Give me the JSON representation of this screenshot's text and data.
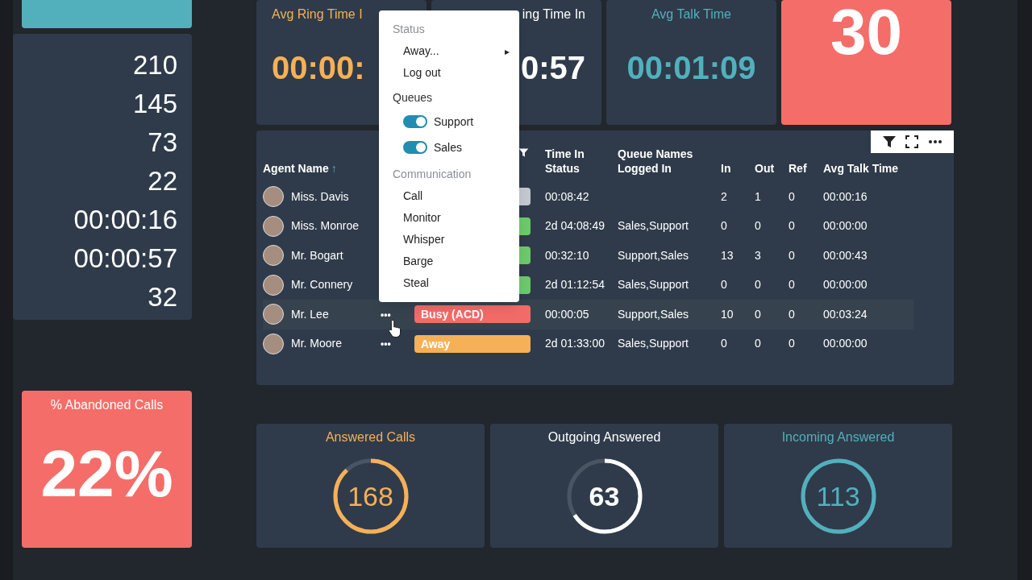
{
  "left_stats": {
    "values": [
      "210",
      "145",
      "73",
      "22",
      "00:00:16",
      "00:00:57",
      "32"
    ]
  },
  "abandoned": {
    "title": "% Abandoned Calls",
    "value": "22%"
  },
  "top_tiles": [
    {
      "kind": "metric",
      "title": "Avg Ring Time I",
      "value": "00:00:"
    },
    {
      "kind": "metric",
      "title": "ing Time In",
      "value": "0:57"
    },
    {
      "kind": "metric",
      "title": "Avg Talk Time",
      "value": "00:01:09"
    },
    {
      "kind": "alert",
      "value": "30"
    }
  ],
  "table": {
    "columns": [
      {
        "kind": "text",
        "label": "Agent Name",
        "sort_indicator": "↑"
      },
      {
        "kind": "blank"
      },
      {
        "kind": "filter"
      },
      {
        "kind": "text",
        "label": "Time In Status"
      },
      {
        "kind": "text",
        "label": "Queue Names Logged In"
      },
      {
        "kind": "text",
        "label": "In"
      },
      {
        "kind": "text",
        "label": "Out"
      },
      {
        "kind": "text",
        "label": "Ref"
      },
      {
        "kind": "text",
        "label": "Avg Talk Time"
      }
    ],
    "rows": [
      {
        "agent": "Miss. Davis",
        "color": "#c3c7cf",
        "time": "00:08:42",
        "queues": "",
        "in": "2",
        "out": "1",
        "ref": "0",
        "avg_talk": "00:00:16",
        "hovered": false
      },
      {
        "agent": "Miss. Monroe",
        "color": "#6cc96a",
        "time": "2d 04:08:49",
        "queues": "Sales,Support",
        "in": "0",
        "out": "0",
        "ref": "0",
        "avg_talk": "00:00:00",
        "hovered": false
      },
      {
        "agent": "Mr. Bogart",
        "color": "#6cc96a",
        "time": "00:32:10",
        "queues": "Support,Sales",
        "in": "13",
        "out": "3",
        "ref": "0",
        "avg_talk": "00:00:43",
        "hovered": false
      },
      {
        "agent": "Mr. Connery",
        "color": "#6cc96a",
        "time": "2d 01:12:54",
        "queues": "Sales,Support",
        "in": "0",
        "out": "0",
        "ref": "0",
        "avg_talk": "00:00:00",
        "hovered": false
      },
      {
        "agent": "Mr. Lee",
        "actions": "•••",
        "status": "Busy (ACD)",
        "color": "#f26b68",
        "time": "00:00:05",
        "queues": "Support,Sales",
        "in": "10",
        "out": "0",
        "ref": "0",
        "avg_talk": "00:03:24",
        "hovered": true
      },
      {
        "agent": "Mr. Moore",
        "actions": "•••",
        "status": "Away",
        "color": "#f6b057",
        "time": "2d 01:33:00",
        "queues": "Sales,Support",
        "in": "0",
        "out": "0",
        "ref": "0",
        "avg_talk": "00:00:00",
        "hovered": false
      }
    ]
  },
  "context_menu": {
    "sections": [
      {
        "heading": "Status",
        "muted": true,
        "items": [
          {
            "kind": "submenu",
            "label": "Away...",
            "arrow": "▸"
          },
          {
            "kind": "action",
            "label": "Log out"
          }
        ]
      },
      {
        "heading": "Queues",
        "muted": false,
        "items": [
          {
            "kind": "toggle",
            "label": "Support",
            "on": true
          },
          {
            "kind": "toggle",
            "label": "Sales",
            "on": true
          }
        ]
      },
      {
        "heading": "Communication",
        "muted": true,
        "items": [
          {
            "kind": "action",
            "label": "Call"
          },
          {
            "kind": "action",
            "label": "Monitor"
          },
          {
            "kind": "action",
            "label": "Whisper"
          },
          {
            "kind": "action",
            "label": "Barge"
          },
          {
            "kind": "action",
            "label": "Steal"
          }
        ]
      }
    ]
  },
  "gauges": [
    {
      "title": "Answered Calls",
      "value": "168"
    },
    {
      "title": "Outgoing Answered",
      "value": "63"
    },
    {
      "title": "Incoming Answered",
      "value": "113"
    }
  ]
}
